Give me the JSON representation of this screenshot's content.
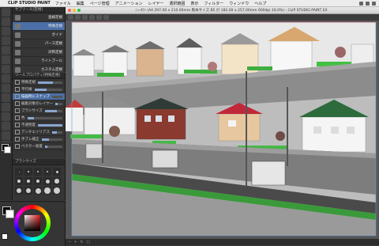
{
  "menubar": {
    "apple_icon": "apple-icon",
    "app_name": "CLIP STUDIO PAINT",
    "items": [
      "ファイル",
      "編集",
      "ページ管理",
      "アニメーション",
      "レイヤー",
      "選択範囲",
      "表示",
      "フィルター",
      "ウィンドウ",
      "ヘルプ"
    ]
  },
  "window": {
    "title": "ﾆｭｰﾀｳﾝ (A4 297.00 x 210.00mm 製本サイズ B5 ﾀﾃ 182.00 x 257.00mm 600dpi 16.0%) - CLIP STUDIO PAINT EX"
  },
  "tools": [
    "zoom-icon",
    "move-icon",
    "operation-icon",
    "select-icon",
    "eyedropper-icon",
    "pen-icon",
    "pencil-icon",
    "brush-icon",
    "airbrush-icon",
    "decoration-icon",
    "eraser-icon",
    "blend-icon",
    "fill-icon",
    "gradient-icon",
    "figure-icon",
    "frame-icon",
    "ruler-icon",
    "text-icon",
    "balloon-icon",
    "line-correction-icon"
  ],
  "sub_tool": {
    "header": "サブツール[定規]",
    "items": [
      {
        "label": "直線定規",
        "selected": false
      },
      {
        "label": "特殊定規",
        "selected": true
      },
      {
        "label": "ガイド",
        "selected": false
      },
      {
        "label": "パース定規",
        "selected": false
      },
      {
        "label": "対称定規",
        "selected": false
      },
      {
        "label": "ライトブール",
        "selected": false
      },
      {
        "label": "カスタム定規",
        "selected": false
      }
    ]
  },
  "tool_property": {
    "header": "ツールプロパティ[特殊定規]",
    "rows": [
      {
        "label": "特殊定規",
        "value": 0.6,
        "highlight": false
      },
      {
        "label": "平行線",
        "value": 0.45,
        "highlight": false
      },
      {
        "label": "描画時にスナップ",
        "value": 0,
        "highlight": true
      },
      {
        "label": "編集対象のレイヤー",
        "value": 0.3,
        "highlight": false
      },
      {
        "label": "ブラシサイズ",
        "value": 0.7,
        "highlight": false
      },
      {
        "label": "色",
        "value": 0.2,
        "highlight": false
      },
      {
        "label": "不透明度",
        "value": 1.0,
        "highlight": false
      },
      {
        "label": "アンチエイリアス",
        "value": 0.5,
        "highlight": false
      },
      {
        "label": "手ブレ補正",
        "value": 0.35,
        "highlight": false
      },
      {
        "label": "ベクター吸着",
        "value": 0.15,
        "highlight": false
      }
    ]
  },
  "brush_size": {
    "header": "ブラシサイズ"
  },
  "colors": {
    "main": "#000000",
    "sub": "#ffffff",
    "accent": "#4b6fa6"
  }
}
